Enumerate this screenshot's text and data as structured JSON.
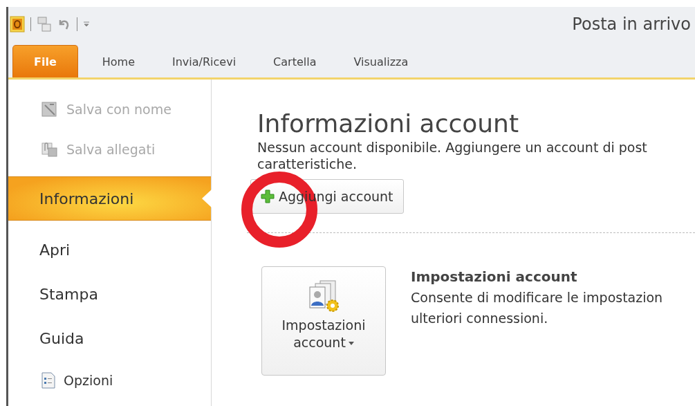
{
  "window": {
    "title": "Posta in arrivo"
  },
  "ribbon_tabs": [
    {
      "label": "File",
      "selected": true
    },
    {
      "label": "Home",
      "selected": false
    },
    {
      "label": "Invia/Ricevi",
      "selected": false
    },
    {
      "label": "Cartella",
      "selected": false
    },
    {
      "label": "Visualizza",
      "selected": false
    }
  ],
  "backstage_menu": [
    {
      "label": "Salva con nome",
      "kind": "save-as",
      "disabled": true,
      "selected": false
    },
    {
      "label": "Salva allegati",
      "kind": "save-attachments",
      "disabled": true,
      "selected": false
    },
    {
      "label": "Informazioni",
      "kind": "page",
      "disabled": false,
      "selected": true
    },
    {
      "label": "Apri",
      "kind": "page",
      "disabled": false,
      "selected": false
    },
    {
      "label": "Stampa",
      "kind": "page",
      "disabled": false,
      "selected": false
    },
    {
      "label": "Guida",
      "kind": "page",
      "disabled": false,
      "selected": false
    },
    {
      "label": "Opzioni",
      "kind": "options",
      "disabled": false,
      "selected": false
    }
  ],
  "account_info": {
    "title": "Informazioni account",
    "description": [
      "Nessun account disponibile. Aggiungere un account di post",
      "caratteristiche."
    ],
    "add_button": "Aggiungi account",
    "settings": {
      "button_label": [
        "Impostazioni",
        "account"
      ],
      "heading": "Impostazioni account",
      "description": [
        "Consente di modificare le impostazion",
        "ulteriori connessioni."
      ]
    }
  },
  "annotation": {
    "kind": "circle"
  }
}
